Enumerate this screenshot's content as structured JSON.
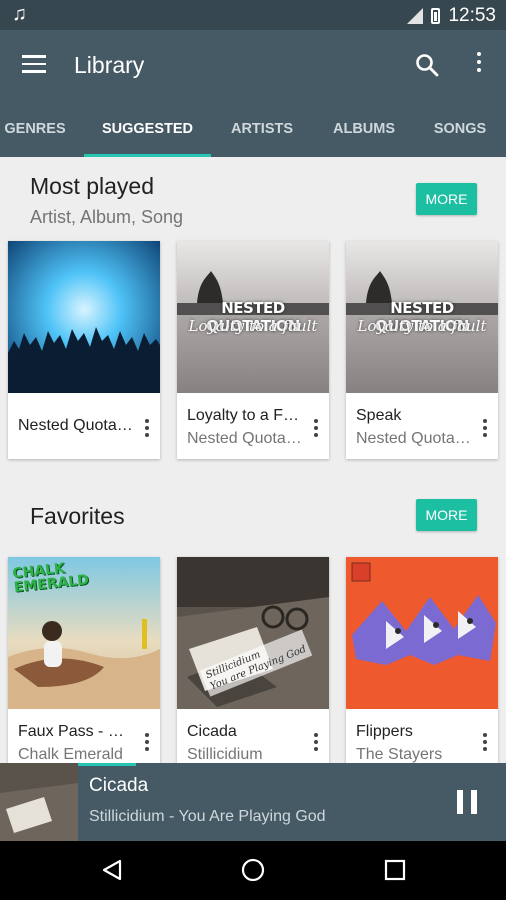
{
  "status_bar": {
    "time": "12:53",
    "notification_icon": "music-note-icon"
  },
  "app_bar": {
    "title": "Library",
    "icons": [
      "menu-icon",
      "search-icon",
      "more-vert-icon"
    ]
  },
  "tabs": [
    {
      "label": "Genres",
      "active": false
    },
    {
      "label": "Suggested",
      "active": true
    },
    {
      "label": "Artists",
      "active": false
    },
    {
      "label": "Albums",
      "active": false
    },
    {
      "label": "Songs",
      "active": false
    }
  ],
  "sections": [
    {
      "title": "Most played",
      "subtitle": "Artist, Album, Song",
      "more_label": "More",
      "items": [
        {
          "title": "Nested Quotation",
          "subtitle": ""
        },
        {
          "title": "Loyalty to a Fault",
          "subtitle": "Nested Quotation"
        },
        {
          "title": "Speak",
          "subtitle": "Nested Quotation"
        }
      ]
    },
    {
      "title": "Favorites",
      "more_label": "More",
      "items": [
        {
          "title": "Faux Pass - Goodbye",
          "subtitle": "Chalk Emerald"
        },
        {
          "title": "Cicada",
          "subtitle": "Stillicidium"
        },
        {
          "title": "Flippers",
          "subtitle": "The Stayers"
        }
      ]
    }
  ],
  "album_art_text": {
    "nested_line1": "NESTED QUOTATION",
    "nested_line2": "Loyalty to a fault",
    "chalk_line1": "CHALK",
    "chalk_line2": "EMERALD",
    "cicada_line1": "Stillicidium",
    "cicada_line2": "You are Playing God"
  },
  "now_playing": {
    "title": "Cicada",
    "subtitle": "Stillicidium - You Are Playing God",
    "progress": 0.12,
    "state_icon": "pause-icon"
  },
  "nav_bar": {
    "icons": [
      "back-icon",
      "home-icon",
      "recents-icon"
    ]
  },
  "colors": {
    "app_bar": "#455a64",
    "status_bar": "#37474f",
    "accent": "#1dbfa3",
    "background": "#eeeeee"
  }
}
